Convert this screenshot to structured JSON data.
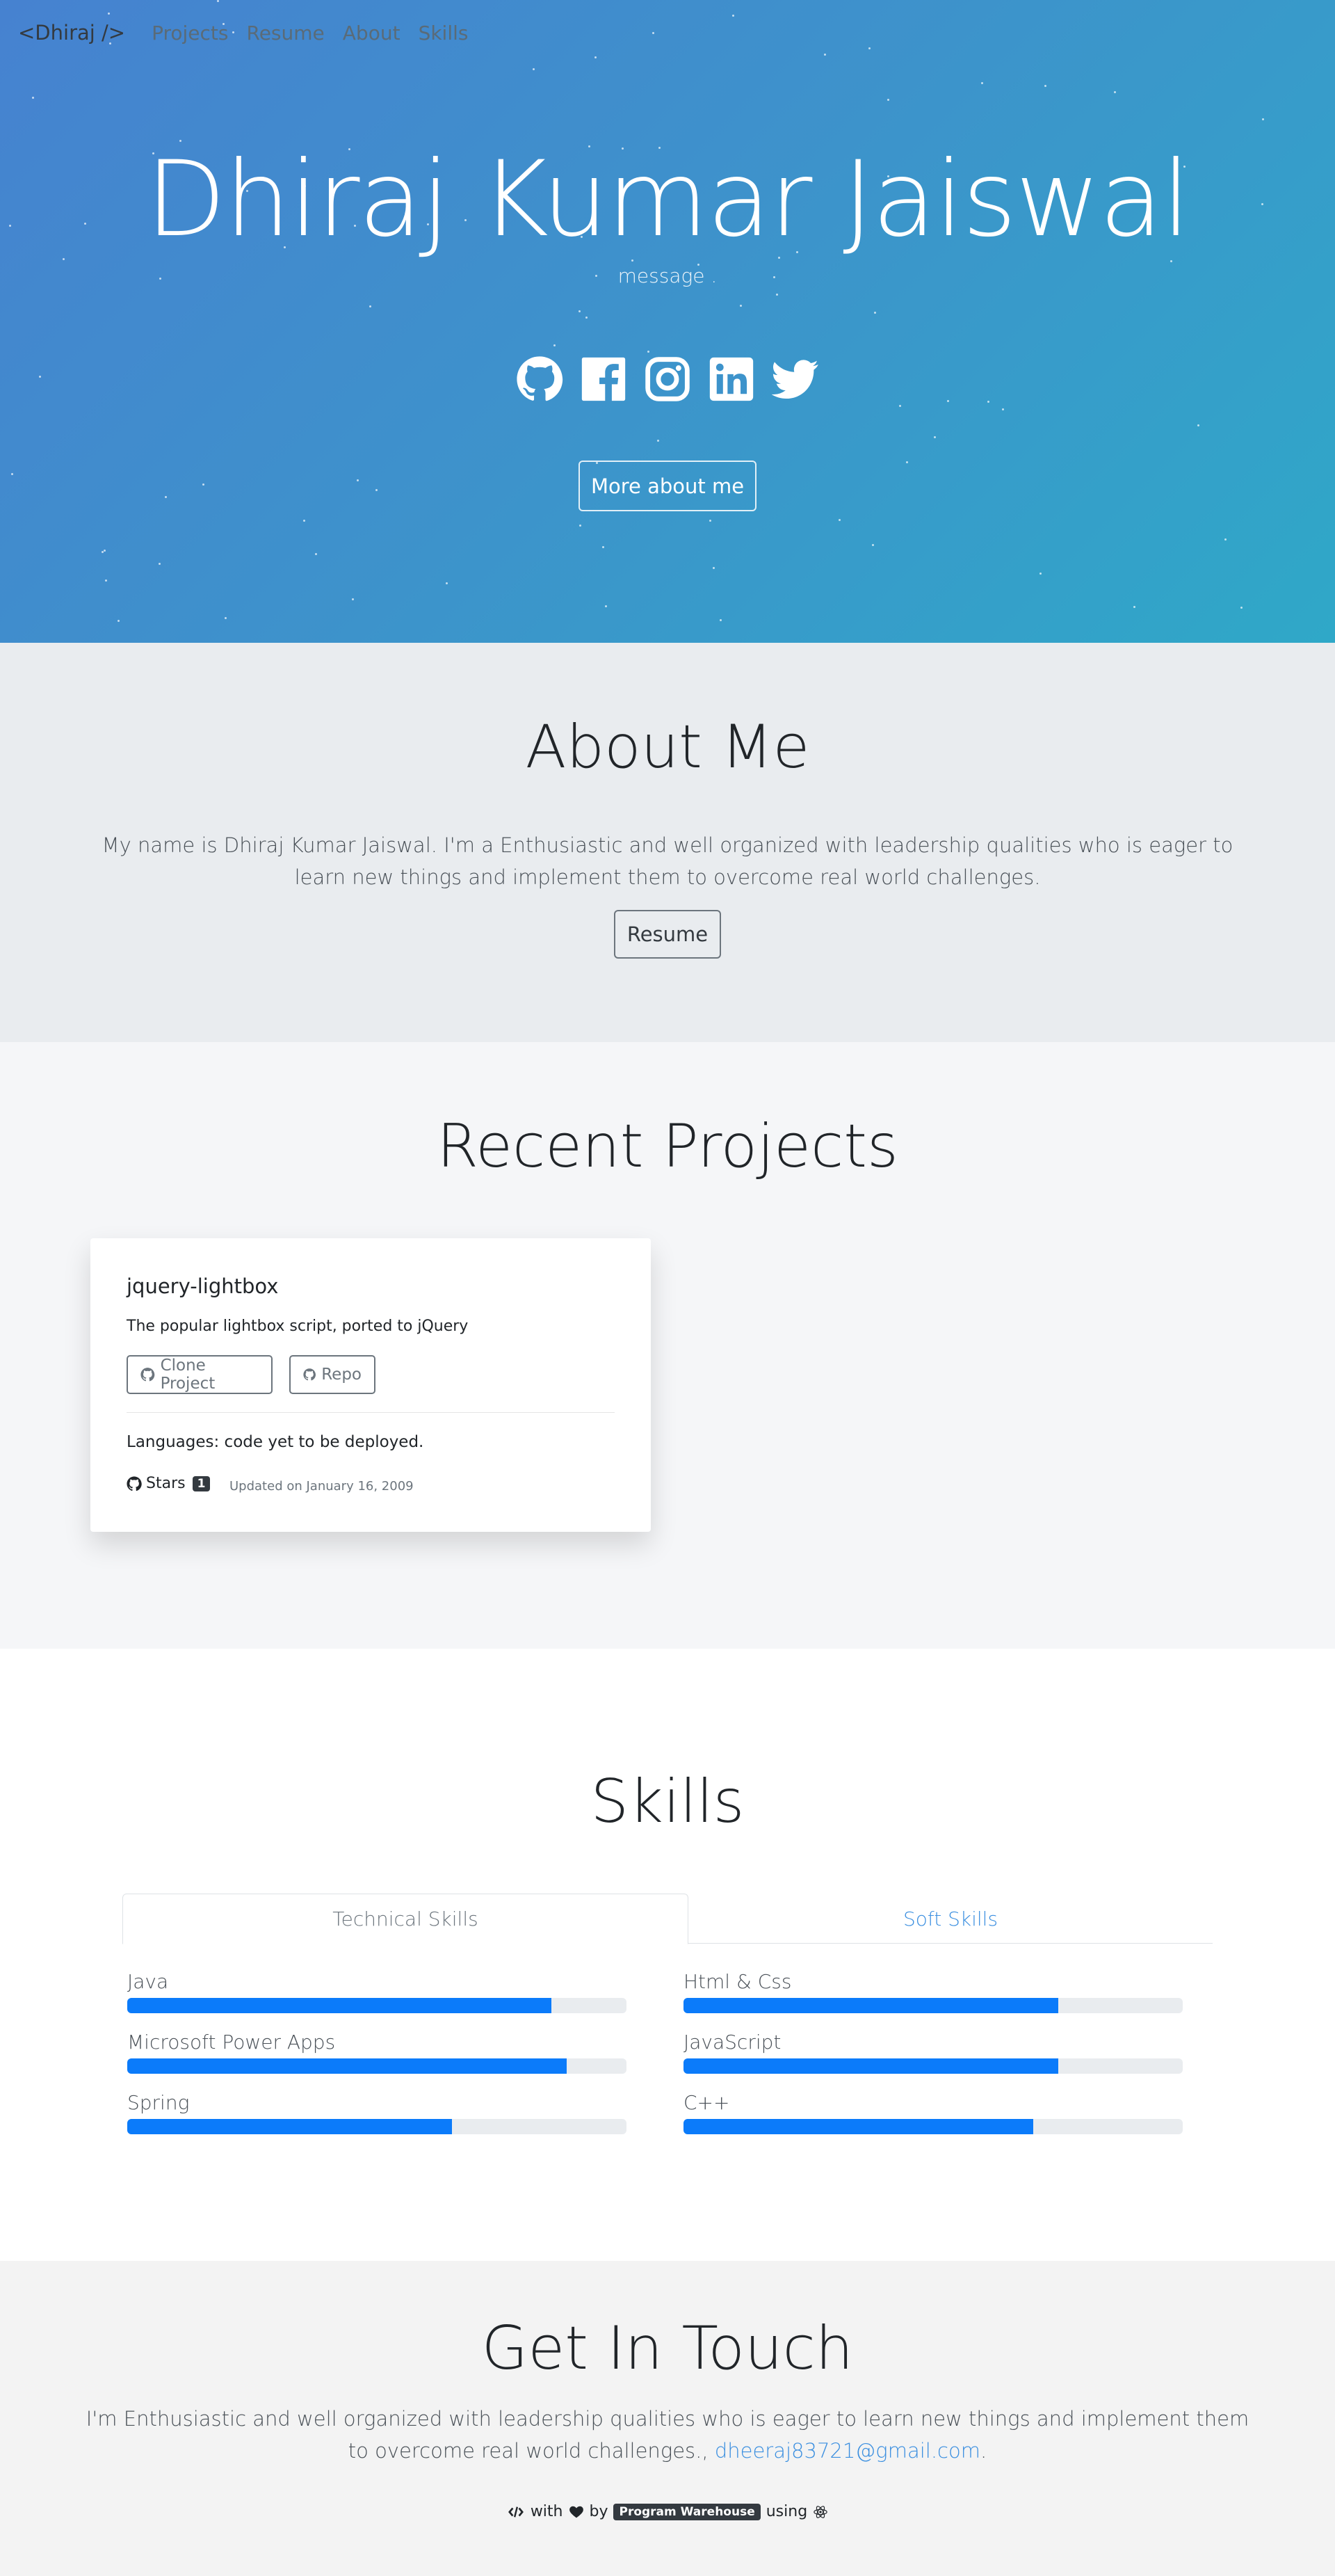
{
  "nav": {
    "brand": "<Dhiraj />",
    "links": [
      "Projects",
      "Resume",
      "About",
      "Skills"
    ]
  },
  "hero": {
    "title": "Dhiraj Kumar Jaiswal",
    "message": "message .",
    "socials": [
      "github-icon",
      "facebook-icon",
      "instagram-icon",
      "linkedin-icon",
      "twitter-icon"
    ],
    "more_button": "More about me"
  },
  "about": {
    "title": "About Me",
    "text": "My name is Dhiraj Kumar Jaiswal. I'm a Enthusiastic and well organized with leadership qualities who is eager to learn new things and implement them to overcome real world challenges.",
    "resume_button": "Resume"
  },
  "projects": {
    "title": "Recent Projects",
    "cards": [
      {
        "name": "jquery-lightbox",
        "description": "The popular lightbox script, ported to jQuery",
        "clone_label": "Clone Project",
        "repo_label": "Repo",
        "languages": "Languages: code yet to be deployed.",
        "stars_label": "Stars",
        "stars_count": "1",
        "updated": "Updated on January 16, 2009"
      }
    ]
  },
  "skills": {
    "title": "Skills",
    "tabs": [
      "Technical Skills",
      "Soft Skills"
    ],
    "active_tab": "Technical Skills",
    "left": [
      {
        "name": "Java",
        "level": 0.85
      },
      {
        "name": "Microsoft Power Apps",
        "level": 0.88
      },
      {
        "name": "Spring",
        "level": 0.65
      }
    ],
    "right": [
      {
        "name": "Html & Css",
        "level": 0.75
      },
      {
        "name": "JavaScript",
        "level": 0.75
      },
      {
        "name": "C++",
        "level": 0.7
      }
    ],
    "bar_color": "#0b7bfa"
  },
  "contact": {
    "title": "Get In Touch",
    "text": "I'm Enthusiastic and well organized with leadership qualities who is eager to learn new things and implement them to overcome real world challenges.,",
    "email": "dheeraj83721@gmail.com",
    "trailing": ".",
    "footer": {
      "with": "with",
      "by": "by",
      "badge": "Program Warehouse",
      "using": "using"
    }
  },
  "colors": {
    "hero_start": "#4682d0",
    "hero_end": "#2fa8c8",
    "link": "#3b8fe0"
  }
}
